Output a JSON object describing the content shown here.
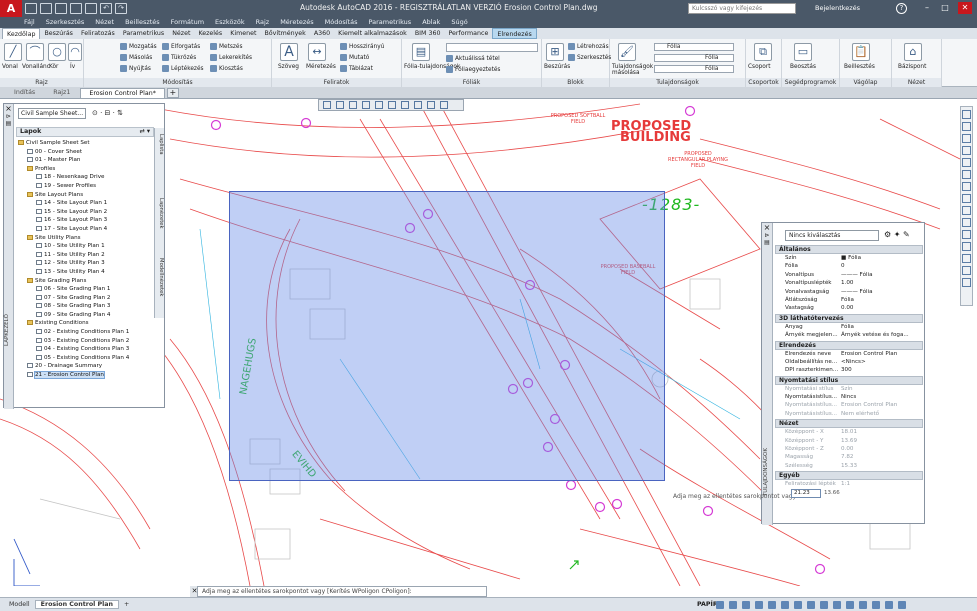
{
  "window": {
    "title": "Autodesk AutoCAD 2016 - REGISZTRÁLATLAN VERZIÓ   Erosion Control Plan.dwg",
    "search_placeholder": "Kulcsszó vagy kifejezés",
    "signin": "Bejelentkezés"
  },
  "menu": [
    "Fájl",
    "Szerkesztés",
    "Nézet",
    "Beillesztés",
    "Formátum",
    "Eszközök",
    "Rajz",
    "Méretezés",
    "Módosítás",
    "Parametrikus",
    "Ablak",
    "Súgó"
  ],
  "ribbon_tabs": [
    {
      "label": "Kezdőlap",
      "active": true
    },
    {
      "label": "Beszúrás"
    },
    {
      "label": "Feliratozás"
    },
    {
      "label": "Parametrikus"
    },
    {
      "label": "Nézet"
    },
    {
      "label": "Kezelés"
    },
    {
      "label": "Kimenet"
    },
    {
      "label": "Bővítmények"
    },
    {
      "label": "A360"
    },
    {
      "label": "Kiemelt alkalmazások"
    },
    {
      "label": "BIM 360"
    },
    {
      "label": "Performance"
    },
    {
      "label": "Elrendezés",
      "contextual": true
    }
  ],
  "ribbon": {
    "draw": {
      "label": "Rajz",
      "buttons": [
        "Vonal",
        "Vonallánc",
        "Kör",
        "Ív"
      ]
    },
    "modify": {
      "label": "Módosítás",
      "buttons": [
        "Mozgatás",
        "Elforgatás",
        "Metszés",
        "Másolás",
        "Tükrözés",
        "Lekerekítés",
        "Nyújtás",
        "Léptékezés",
        "Kiosztás"
      ]
    },
    "annotation": {
      "label": "Feliratok",
      "buttons": [
        "Szöveg",
        "Méretezés",
        "Hosszirányú",
        "Mutató",
        "Táblázat"
      ]
    },
    "layers": {
      "label": "Fóliák",
      "buttons": [
        "Fólia-tulajdonságok",
        "Aktuálissá tétel",
        "Fóliaegyeztetés"
      ]
    },
    "block": {
      "label": "Blokk",
      "buttons": [
        "Beszúrás",
        "Létrehozás",
        "Szerkesztés"
      ]
    },
    "properties": {
      "label": "Tulajdonságok",
      "buttons": [
        "Tulajdonságok másolása",
        "Fólia",
        "Fólia",
        "Fólia"
      ]
    },
    "groups": {
      "label": "Csoportok",
      "buttons": [
        "Csoport"
      ]
    },
    "utilities": {
      "label": "Segédprogramok",
      "buttons": [
        "Beosztás"
      ]
    },
    "clipboard": {
      "label": "Vágólap",
      "buttons": [
        "Beillesztés"
      ]
    },
    "view": {
      "label": "Nézet",
      "buttons": [
        "Bázispont"
      ]
    }
  },
  "file_tabs": [
    {
      "label": "Indítás"
    },
    {
      "label": "Rajz1"
    },
    {
      "label": "Erosion Control Plan*",
      "active": true
    }
  ],
  "drawing_labels": {
    "proposed_building": "PROPOSED",
    "proposed_building_2": "BUILDING",
    "softball": "PROPOSED SOFTBALL FIELD",
    "rect_field": "PROPOSED RECTANGULAR PLAYING FIELD",
    "baseball": "PROPOSED BASEBALL FIELD",
    "contour": "-1283-",
    "street_1": "NAGEHUGS",
    "street_2": "EVIHD"
  },
  "sheet_set": {
    "palette_title": "LAPKEZELŐ",
    "combo": "Civil Sample Sheet...",
    "header": "Lapok",
    "side_tabs": [
      "Laplista",
      "Lapnézetek",
      "Modellnézetek"
    ],
    "tree": [
      {
        "level": 0,
        "type": "folder",
        "label": "Civil Sample Sheet Set"
      },
      {
        "level": 1,
        "type": "sheet",
        "label": "00 - Cover Sheet"
      },
      {
        "level": 1,
        "type": "sheet",
        "label": "01 - Master Plan"
      },
      {
        "level": 1,
        "type": "folder",
        "label": "Profiles"
      },
      {
        "level": 2,
        "type": "sheet",
        "label": "18 - Nesenkaag Drive"
      },
      {
        "level": 2,
        "type": "sheet",
        "label": "19 - Sewer Profiles"
      },
      {
        "level": 1,
        "type": "folder",
        "label": "Site Layout Plans"
      },
      {
        "level": 2,
        "type": "sheet",
        "label": "14 - Site Layout Plan 1"
      },
      {
        "level": 2,
        "type": "sheet",
        "label": "15 - Site Layout Plan 2"
      },
      {
        "level": 2,
        "type": "sheet",
        "label": "16 - Site Layout Plan 3"
      },
      {
        "level": 2,
        "type": "sheet",
        "label": "17 - Site Layout Plan 4"
      },
      {
        "level": 1,
        "type": "folder",
        "label": "Site Utility Plans"
      },
      {
        "level": 2,
        "type": "sheet",
        "label": "10 - Site Utility Plan 1"
      },
      {
        "level": 2,
        "type": "sheet",
        "label": "11 - Site Utility Plan 2"
      },
      {
        "level": 2,
        "type": "sheet",
        "label": "12 - Site Utility Plan 3"
      },
      {
        "level": 2,
        "type": "sheet",
        "label": "13 - Site Utility Plan 4"
      },
      {
        "level": 1,
        "type": "folder",
        "label": "Site Grading Plans"
      },
      {
        "level": 2,
        "type": "sheet",
        "label": "06 - Site Grading Plan 1"
      },
      {
        "level": 2,
        "type": "sheet",
        "label": "07 - Site Grading Plan 2"
      },
      {
        "level": 2,
        "type": "sheet",
        "label": "08 - Site Grading Plan 3"
      },
      {
        "level": 2,
        "type": "sheet",
        "label": "09 - Site Grading Plan 4"
      },
      {
        "level": 1,
        "type": "folder",
        "label": "Existing Conditions"
      },
      {
        "level": 2,
        "type": "sheet",
        "label": "02 - Existing Conditions Plan 1"
      },
      {
        "level": 2,
        "type": "sheet",
        "label": "03 - Existing Conditions Plan 2"
      },
      {
        "level": 2,
        "type": "sheet",
        "label": "04 - Existing Conditions Plan 3"
      },
      {
        "level": 2,
        "type": "sheet",
        "label": "05 - Existing Conditions Plan 4"
      },
      {
        "level": 1,
        "type": "sheet",
        "label": "20 - Drainage Summary"
      },
      {
        "level": 1,
        "type": "sheet",
        "label": "21 - Erosion Control Plan",
        "selected": true
      }
    ]
  },
  "properties": {
    "palette_title": "TULAJDONSÁGOK",
    "combo": "Nincs kiválasztás",
    "sections": [
      {
        "title": "Általános",
        "rows": [
          [
            "Szín",
            "■ Fólia"
          ],
          [
            "Fólia",
            "0"
          ],
          [
            "Vonaltípus",
            "——— Fólia"
          ],
          [
            "Vonaltípuslépték",
            "1.00"
          ],
          [
            "Vonalvastagság",
            "——— Fólia"
          ],
          [
            "Átlátszóság",
            "Fólia"
          ],
          [
            "Vastagság",
            "0.00"
          ]
        ]
      },
      {
        "title": "3D láthatótervezés",
        "rows": [
          [
            "Anyag",
            "Fólia"
          ],
          [
            "Árnyék megjelen...",
            "Árnyék vetése és foga..."
          ]
        ]
      },
      {
        "title": "Elrendezés",
        "rows": [
          [
            "Elrendezés neve",
            "Erosion Control Plan"
          ],
          [
            "Oldalbeállítás ne...",
            "<Nincs>"
          ],
          [
            "DPI raszterkimen...",
            "300"
          ]
        ]
      },
      {
        "title": "Nyomtatási stílus",
        "rows": [
          [
            "Nyomtatási stílus",
            "Szín",
            true
          ],
          [
            "Nyomtatásistílus...",
            "Nincs"
          ],
          [
            "Nyomtatásistílus...",
            "Erosion Control Plan",
            true
          ],
          [
            "Nyomtatásistílus...",
            "Nem elérhető",
            true
          ]
        ]
      },
      {
        "title": "Nézet",
        "rows": [
          [
            "Középpont - X",
            "18.01",
            true
          ],
          [
            "Középpont - Y",
            "13.69",
            true
          ],
          [
            "Középpont - Z",
            "0.00",
            true
          ],
          [
            "Magasság",
            "7.82",
            true
          ],
          [
            "Szélesség",
            "15.33",
            true
          ]
        ]
      },
      {
        "title": "Egyéb",
        "rows": [
          [
            "Feliratozási lépték",
            "1:1",
            true
          ]
        ]
      }
    ]
  },
  "dynamic_input": {
    "tooltip": "Adja meg az ellentétes sarokpontot vagy",
    "value_x": "21.23",
    "value_y": "13.66"
  },
  "command_line": "Adja meg az ellentétes sarokpontot vagy [Kerítés WPoligon CPoligon]:",
  "status_tabs": [
    {
      "label": "Modell"
    },
    {
      "label": "Erosion Control Plan",
      "active": true
    }
  ],
  "status_space": "PAPÍR",
  "colors": {
    "accent": "#c8171d",
    "title_bar": "#4a5868",
    "selection": "#698ce6",
    "cad_red": "#e63a3a",
    "cad_magenta": "#d53cd5",
    "cad_green": "#1fb81f"
  }
}
